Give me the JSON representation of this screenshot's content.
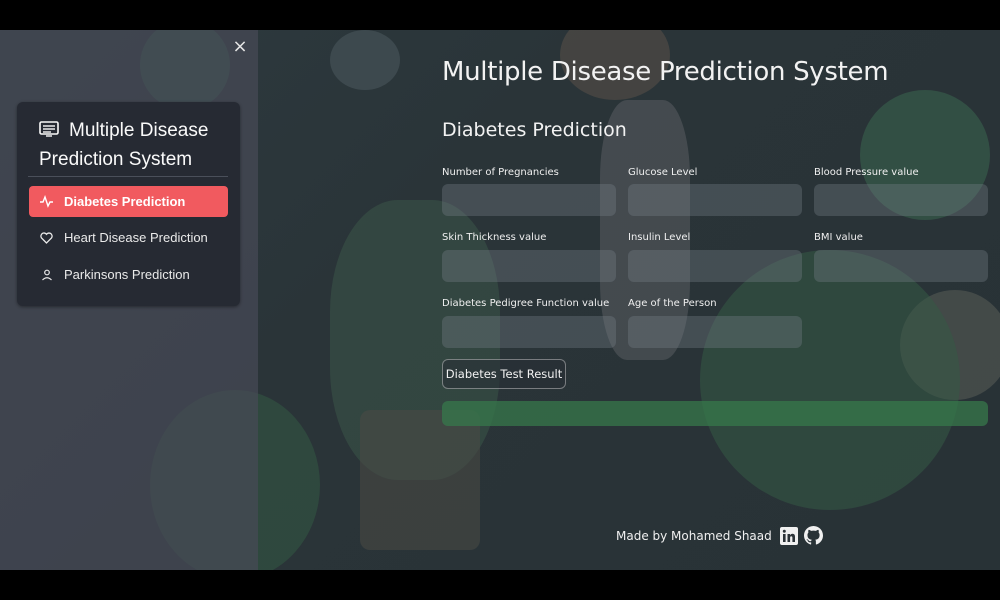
{
  "sidebar": {
    "close_icon": "×",
    "menu_title": "Multiple Disease Prediction System",
    "menu_icon": "document-list-icon",
    "items": [
      {
        "label": "Diabetes Prediction",
        "icon": "activity-icon",
        "active": true
      },
      {
        "label": "Heart Disease Prediction",
        "icon": "heart-icon",
        "active": false
      },
      {
        "label": "Parkinsons Prediction",
        "icon": "person-icon",
        "active": false
      }
    ]
  },
  "main": {
    "title": "Multiple Disease Prediction System",
    "subtitle": "Diabetes Prediction",
    "fields": [
      {
        "label": "Number of Pregnancies",
        "value": ""
      },
      {
        "label": "Glucose Level",
        "value": ""
      },
      {
        "label": "Blood Pressure value",
        "value": ""
      },
      {
        "label": "Skin Thickness value",
        "value": ""
      },
      {
        "label": "Insulin Level",
        "value": ""
      },
      {
        "label": "BMI value",
        "value": ""
      },
      {
        "label": "Diabetes Pedigree Function value",
        "value": ""
      },
      {
        "label": "Age of the Person",
        "value": ""
      }
    ],
    "button_label": "Diabetes Test Result",
    "result_text": ""
  },
  "footer": {
    "credit": "Made by Mohamed Shaad",
    "icons": [
      "linkedin-icon",
      "github-icon"
    ]
  },
  "colors": {
    "accent": "#f15a5f",
    "result": "#37784b",
    "sidebar_card": "#262a33"
  }
}
